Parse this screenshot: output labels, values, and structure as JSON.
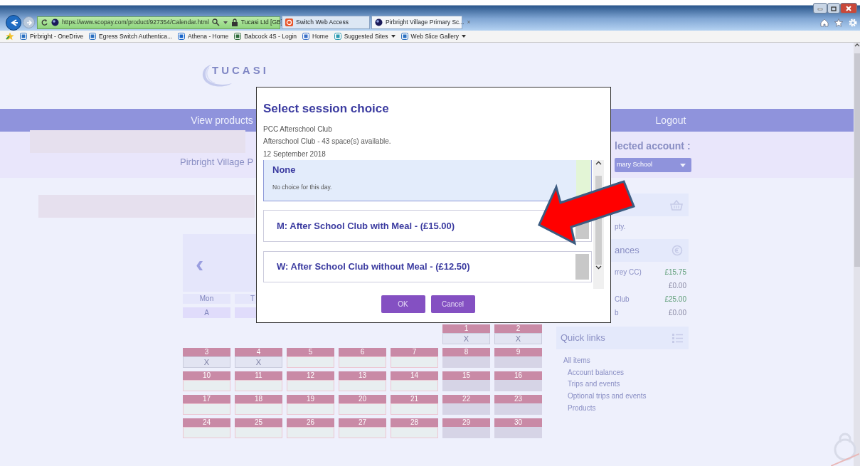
{
  "browser": {
    "address": {
      "url": "https://www.scopay.com/product/927354/Calendar.html",
      "identity": "Tucasi Ltd [GB]"
    },
    "tabs": [
      {
        "label": "Switch Web Access",
        "selected": false,
        "closable": false
      },
      {
        "label": "Pirbright Village Primary Sc...",
        "selected": true,
        "closable": true
      }
    ],
    "close_glyph": "×",
    "favorites": [
      {
        "label": "Pirbright - OneDrive",
        "menu": false
      },
      {
        "label": "Egress Switch  Authentica...",
        "menu": false
      },
      {
        "label": "Athena - Home",
        "menu": false
      },
      {
        "label": "Babcock 4S - Login",
        "menu": false
      },
      {
        "label": "Home",
        "menu": false
      },
      {
        "label": "Suggested Sites",
        "menu": true
      },
      {
        "label": "Web Slice Gallery",
        "menu": true
      }
    ]
  },
  "page": {
    "logo": "TUCASI",
    "nav": [
      "View products",
      "Logout"
    ],
    "school_name": "Pirbright Village P",
    "account_label": "lected account :",
    "account_select": "mary School",
    "basket_text": "pty.",
    "balances_title": "ances",
    "balances": [
      {
        "label": "rrey CC)",
        "amount": "£15.75",
        "color": "#5f9e78"
      },
      {
        "amount": "£0.00",
        "color": "#8a8aa4"
      },
      {
        "label": "Club",
        "amount": "£25.00",
        "color": "#5f9e78"
      },
      {
        "label": "b",
        "amount": "£0.00",
        "color": "#8a8aa4"
      }
    ],
    "quick_links_title": "Quick links",
    "quick_links": [
      {
        "label": "All items",
        "children": [
          {
            "label": "Account balances"
          },
          {
            "label": "Trips and events"
          },
          {
            "label": "Optional trips and events"
          },
          {
            "label": "Products"
          }
        ]
      }
    ]
  },
  "calendar": {
    "prev": "‹",
    "day_headers": [
      "Mon",
      "T"
    ],
    "legend": [
      "A"
    ],
    "weeks": [
      [
        {
          "kind": "blank"
        },
        {
          "kind": "blank"
        },
        {
          "kind": "blank"
        },
        {
          "kind": "blank"
        },
        {
          "kind": "blank"
        },
        {
          "day": "1",
          "kind": "closed",
          "mark": "X"
        },
        {
          "day": "2",
          "kind": "closed",
          "mark": "X"
        }
      ],
      [
        {
          "day": "3",
          "kind": "closed",
          "mark": "X"
        },
        {
          "day": "4",
          "kind": "closed",
          "mark": "X"
        },
        {
          "day": "5",
          "kind": "open"
        },
        {
          "day": "6",
          "kind": "open"
        },
        {
          "day": "7",
          "kind": "open"
        },
        {
          "day": "8",
          "kind": "weekend"
        },
        {
          "day": "9",
          "kind": "weekend"
        }
      ],
      [
        {
          "day": "10",
          "kind": "open"
        },
        {
          "day": "11",
          "kind": "open"
        },
        {
          "day": "12",
          "kind": "open"
        },
        {
          "day": "13",
          "kind": "open"
        },
        {
          "day": "14",
          "kind": "open"
        },
        {
          "day": "15",
          "kind": "weekend"
        },
        {
          "day": "16",
          "kind": "weekend"
        }
      ],
      [
        {
          "day": "17",
          "kind": "open"
        },
        {
          "day": "18",
          "kind": "open"
        },
        {
          "day": "19",
          "kind": "open"
        },
        {
          "day": "20",
          "kind": "open"
        },
        {
          "day": "21",
          "kind": "open"
        },
        {
          "day": "22",
          "kind": "weekend"
        },
        {
          "day": "23",
          "kind": "weekend"
        }
      ],
      [
        {
          "day": "24",
          "kind": "open"
        },
        {
          "day": "25",
          "kind": "open"
        },
        {
          "day": "26",
          "kind": "open"
        },
        {
          "day": "27",
          "kind": "open"
        },
        {
          "day": "28",
          "kind": "open"
        },
        {
          "day": "29",
          "kind": "weekend"
        },
        {
          "day": "30",
          "kind": "weekend"
        }
      ]
    ]
  },
  "modal": {
    "title": "Select session choice",
    "lines": [
      "PCC Afterschool Club",
      "Afterschool Club - 43 space(s) available.",
      "12 September 2018"
    ],
    "options": [
      {
        "title": "None",
        "description": "No choice for this day.",
        "selected": true
      },
      {
        "title": "M: After School Club with Meal - (£15.00)",
        "selected": false
      },
      {
        "title": "W: After School Club without Meal - (£12.50)",
        "selected": false
      }
    ],
    "buttons": [
      "OK",
      "Cancel"
    ]
  }
}
